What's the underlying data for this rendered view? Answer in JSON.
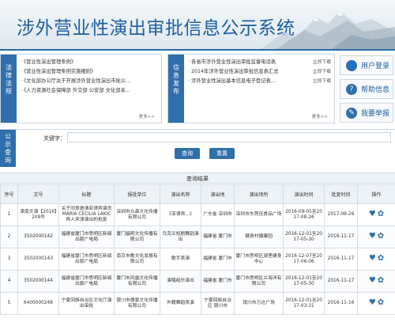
{
  "header": {
    "title": "涉外营业性演出审批信息公示系统"
  },
  "laws": {
    "side_label": [
      "法",
      "律",
      "法",
      "规"
    ],
    "items": [
      "《营业性演出管理条例》",
      "《营业性演出管理条例实施细则》",
      "《文化部办公厅关于开展涉外营业性演出市批公...",
      "《人力资源社会保障部 外交部 公安部 文化部关..."
    ],
    "more": "更多>>"
  },
  "info": {
    "side_label": [
      "信",
      "息",
      "发",
      "布"
    ],
    "items": [
      {
        "text": "各省市涉外营业性演出审批监督电话表",
        "dl": "立即下载"
      },
      {
        "text": "2014年涉外营业性演出审批信息表汇总",
        "dl": "立即下载"
      },
      {
        "text": "涉外营业性演出基本信息电子登记表...",
        "dl": "立即下载"
      }
    ],
    "more": "更多>>"
  },
  "side_buttons": [
    {
      "icon": "user-icon",
      "glyph": "👤",
      "label": "用户登录"
    },
    {
      "icon": "help-icon",
      "glyph": "?",
      "label": "帮助信息"
    },
    {
      "icon": "report-icon",
      "glyph": "✎",
      "label": "我要举报"
    }
  ],
  "query": {
    "side_label": [
      "公",
      "示",
      "查",
      "询"
    ],
    "keyword_label": "关键字：",
    "keyword_value": "",
    "search_label": "查询",
    "reset_label": "重置"
  },
  "results": {
    "title": "查询结果",
    "columns": [
      "序号",
      "文号",
      "标题",
      "报批单位",
      "演出名称",
      "演出地",
      "演出场所",
      "演出时间",
      "批复时间",
      "操作"
    ],
    "rows": [
      [
        "1",
        "津南文演【2016】208号",
        "关于同意邀请菲律宾演员MARIA CECILIA LAKIC 两人来津演出的批复",
        "深圳市众森文化传播有限公司",
        "《菲律宾...》",
        "广东省 深圳市",
        "深圳市东莞佳食品广场",
        "2016-09-05至2017-08-26",
        "2017-08-26"
      ],
      [
        "2",
        "3502000142",
        "福建省厦门市思明区新闻出版广电局",
        "厦门福明文化传播有限公司",
        "乌克兰短剧舞蹈演出",
        "福建省 厦门市",
        "健身村健康园",
        "2016-12-01至2017-05-30",
        "2016-11-17"
      ],
      [
        "3",
        "3502000143",
        "福建省厦门市思明区新闻出版广电局",
        "南京市歌文化发展有限公司",
        "歌手表演",
        "福建省 厦门市",
        "厦门市思明区湖里健身中心",
        "2016-12-07至2017-06-06",
        "2016-11-17"
      ],
      [
        "4",
        "3502000144",
        "福建省厦门市思明区新闻出版广电局",
        "厦门市风凰文化传播有限公司",
        "演唱组乐演出",
        "福建省 厦门市",
        "厦门市思明区兰海洋有限公司",
        "2016-12-01至2017-05-30",
        "2016-11-17"
      ],
      [
        "5",
        "6400000248",
        "宁夏回族自治区文化厅演出审批",
        "银川市德景文化传播有限公司",
        "外籍舞蹈表演",
        "宁夏回族自治区 银川市",
        "银川市万达广场",
        "2016-12-01至2017-03-31",
        "2016-11-16"
      ]
    ]
  },
  "colors": {
    "primary": "#2f6fab",
    "title": "#1f5fa0"
  }
}
